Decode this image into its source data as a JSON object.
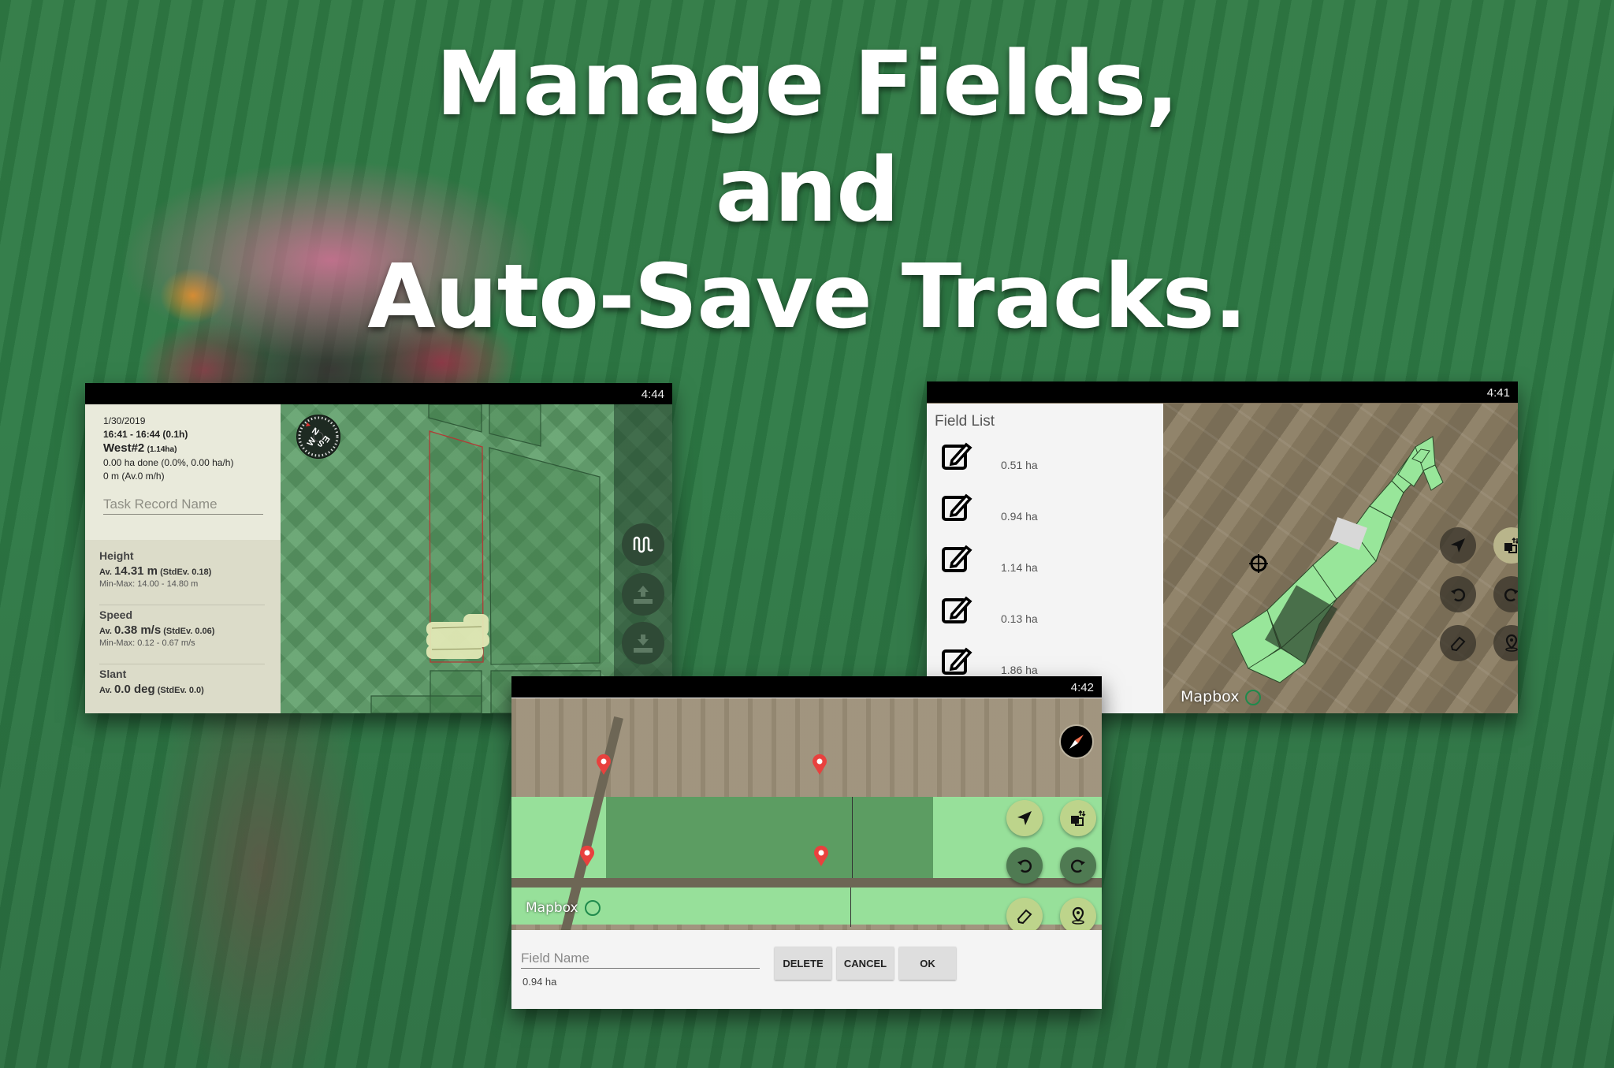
{
  "headline": {
    "line1": "Manage Fields,",
    "line2": "and",
    "line3": "Auto-Save Tracks."
  },
  "task_screen": {
    "clock": "4:44",
    "date": "1/30/2019",
    "time_range": "16:41 - 16:44 (0.1h)",
    "field_name": "West#2",
    "field_area": "(1.14ha)",
    "done": "0.00 ha done (0.0%, 0.00 ha/h)",
    "distance": "0 m (Av.0 m/h)",
    "task_record_placeholder": "Task Record Name",
    "stats": [
      {
        "title": "Height",
        "avg_prefix": "Av.",
        "avg_value": "14.31 m",
        "stddev": "(StdEv. 0.18)",
        "minmax": "Min-Max: 14.00 - 14.80 m"
      },
      {
        "title": "Speed",
        "avg_prefix": "Av.",
        "avg_value": "0.38 m/s",
        "stddev": "(StdEv. 0.06)",
        "minmax": "Min-Max: 0.12 - 0.67 m/s"
      },
      {
        "title": "Slant",
        "avg_prefix": "Av.",
        "avg_value": "0.0 deg",
        "stddev": "(StdEv. 0.0)",
        "minmax": ""
      }
    ],
    "compass_letters": [
      "N",
      "E",
      "S",
      "W"
    ],
    "controls": [
      "wave-pattern-icon",
      "upload-icon",
      "download-icon"
    ]
  },
  "field_list_screen": {
    "clock": "4:41",
    "title": "Field List",
    "fields": [
      {
        "area": "0.51 ha"
      },
      {
        "area": "0.94 ha"
      },
      {
        "area": "1.14 ha"
      },
      {
        "area": "0.13 ha"
      },
      {
        "area": "1.86 ha"
      }
    ],
    "map_attribution": "Mapbox",
    "controls": [
      "navigate-icon",
      "swap-layers-icon",
      "undo-icon",
      "redo-icon",
      "eraser-icon",
      "location-pin-icon"
    ]
  },
  "field_edit_screen": {
    "clock": "4:42",
    "map_attribution": "Mapbox",
    "field_name_placeholder": "Field Name",
    "area": "0.94 ha",
    "buttons": {
      "delete": "DELETE",
      "cancel": "CANCEL",
      "ok": "OK"
    }
  },
  "colors": {
    "field_green": "#97e09a",
    "selected_field": "#5c9d62",
    "pin_red": "#e8413e",
    "control_olive": "#bdd48b"
  }
}
